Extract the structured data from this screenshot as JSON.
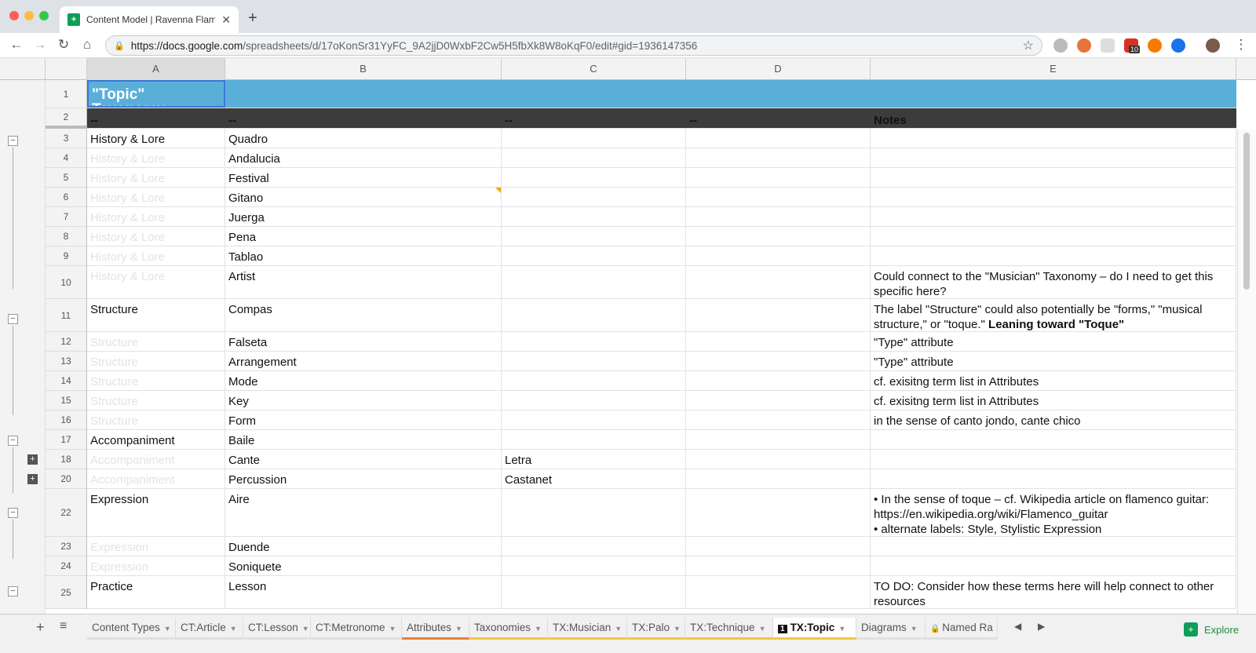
{
  "browser": {
    "tab_title": "Content Model | Ravenna Flam",
    "url_host": "https://docs.google.com",
    "url_path": "/spreadsheets/d/17oKonSr31YyFC_9A2jjD0WxbF2Cw5H5fbXk8W8oKqF0/edit#gid=1936147356",
    "ext_badge": "10"
  },
  "columns": [
    "A",
    "B",
    "C",
    "D",
    "E"
  ],
  "rows": [
    {
      "n": "1",
      "a": "\"Topic\" Taxonomy",
      "b": "",
      "c": "",
      "d": "",
      "e": ""
    },
    {
      "n": "2",
      "a": "--",
      "b": "--",
      "c": "--",
      "d": "--",
      "e": "Notes"
    },
    {
      "n": "3",
      "a": "History & Lore",
      "b": "Quadro",
      "c": "",
      "d": "",
      "e": ""
    },
    {
      "n": "4",
      "a": "History & Lore",
      "b": "Andalucia",
      "c": "",
      "d": "",
      "e": ""
    },
    {
      "n": "5",
      "a": "History & Lore",
      "b": "Festival",
      "c": "",
      "d": "",
      "e": ""
    },
    {
      "n": "6",
      "a": "History & Lore",
      "b": "Gitano",
      "c": "",
      "d": "",
      "e": ""
    },
    {
      "n": "7",
      "a": "History & Lore",
      "b": "Juerga",
      "c": "",
      "d": "",
      "e": ""
    },
    {
      "n": "8",
      "a": "History & Lore",
      "b": "Pena",
      "c": "",
      "d": "",
      "e": ""
    },
    {
      "n": "9",
      "a": "History & Lore",
      "b": "Tablao",
      "c": "",
      "d": "",
      "e": ""
    },
    {
      "n": "10",
      "a": "History & Lore",
      "b": "Artist",
      "c": "",
      "d": "",
      "e": "Could connect to the \"Musician\" Taxonomy – do I need to get this specific here?"
    },
    {
      "n": "11",
      "a": "Structure",
      "b": "Compas",
      "c": "",
      "d": "",
      "e": "The label \"Structure\" could also potentially be \"forms,\" \"musical structure,\" or \"toque.\"",
      "e_bold": "Leaning toward \"Toque\""
    },
    {
      "n": "12",
      "a": "Structure",
      "b": "Falseta",
      "c": "",
      "d": "",
      "e": "\"Type\" attribute"
    },
    {
      "n": "13",
      "a": "Structure",
      "b": "Arrangement",
      "c": "",
      "d": "",
      "e": "\"Type\" attribute"
    },
    {
      "n": "14",
      "a": "Structure",
      "b": "Mode",
      "c": "",
      "d": "",
      "e": "cf. exisitng term list in Attributes"
    },
    {
      "n": "15",
      "a": "Structure",
      "b": "Key",
      "c": "",
      "d": "",
      "e": "cf. exisitng term list in Attributes"
    },
    {
      "n": "16",
      "a": "Structure",
      "b": "Form",
      "c": "",
      "d": "",
      "e": "in the sense of canto jondo, cante chico"
    },
    {
      "n": "17",
      "a": "Accompaniment",
      "b": "Baile",
      "c": "",
      "d": "",
      "e": ""
    },
    {
      "n": "18",
      "a": "Accompaniment",
      "b": "Cante",
      "c": "Letra",
      "d": "",
      "e": ""
    },
    {
      "n": "20",
      "a": "Accompaniment",
      "b": "Percussion",
      "c": "Castanet",
      "d": "",
      "e": ""
    },
    {
      "n": "22",
      "a": "Expression",
      "b": "Aire",
      "c": "",
      "d": "",
      "e": "• In the sense of toque – cf. Wikipedia article on flamenco guitar: https://en.wikipedia.org/wiki/Flamenco_guitar\n• alternate labels: Style, Stylistic Expression"
    },
    {
      "n": "23",
      "a": "Expression",
      "b": "Duende",
      "c": "",
      "d": "",
      "e": ""
    },
    {
      "n": "24",
      "a": "Expression",
      "b": "Soniquete",
      "c": "",
      "d": "",
      "e": ""
    },
    {
      "n": "25",
      "a": "Practice",
      "b": "Lesson",
      "c": "",
      "d": "",
      "e": "TO DO: Consider how these terms here will help connect to other resources"
    }
  ],
  "sheets": [
    {
      "label": "Content Types",
      "color": "#e0e0e0"
    },
    {
      "label": "CT:Article",
      "color": "#e0e0e0"
    },
    {
      "label": "CT:Lesson",
      "color": "#e0e0e0"
    },
    {
      "label": "CT:Metronome",
      "color": "#e0e0e0"
    },
    {
      "label": "Attributes",
      "color": "#e6813a"
    },
    {
      "label": "Taxonomies",
      "color": "#f4c542"
    },
    {
      "label": "TX:Musician",
      "color": "#f4c542"
    },
    {
      "label": "TX:Palo",
      "color": "#f4c542"
    },
    {
      "label": "TX:Technique",
      "color": "#f4c542"
    },
    {
      "label": "TX:Topic",
      "color": "#f4c542",
      "active": true
    },
    {
      "label": "Diagrams",
      "color": "#e0e0e0"
    },
    {
      "label": "Named Ra",
      "color": "#e0e0e0",
      "locked": true
    }
  ],
  "explore_label": "Explore",
  "active_tab_badge": "1"
}
